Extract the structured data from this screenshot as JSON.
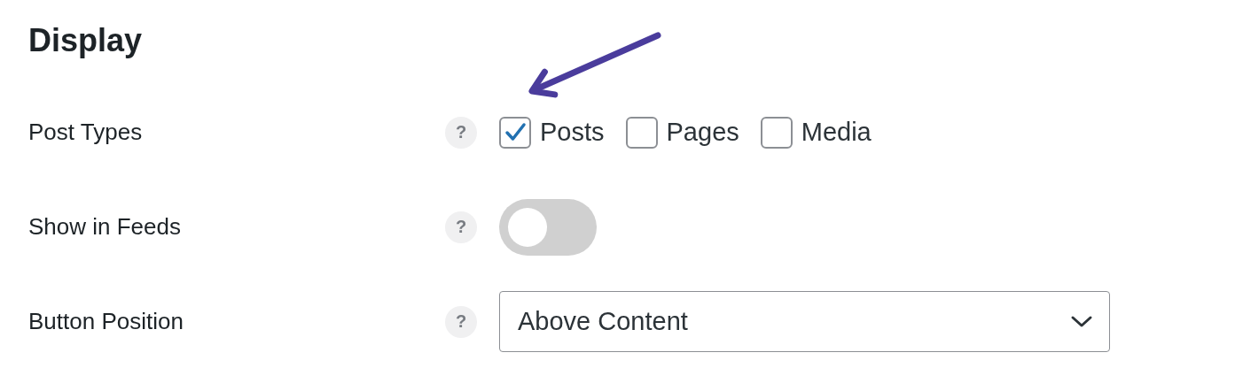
{
  "title": "Display",
  "fields": [
    {
      "kind": "checkboxes",
      "label": "Post Types",
      "help": "?",
      "options": [
        {
          "label": "Posts",
          "checked": true
        },
        {
          "label": "Pages",
          "checked": false
        },
        {
          "label": "Media",
          "checked": false
        }
      ]
    },
    {
      "kind": "toggle",
      "label": "Show in Feeds",
      "help": "?",
      "on": false
    },
    {
      "kind": "select",
      "label": "Button Position",
      "help": "?",
      "value": "Above Content"
    }
  ]
}
